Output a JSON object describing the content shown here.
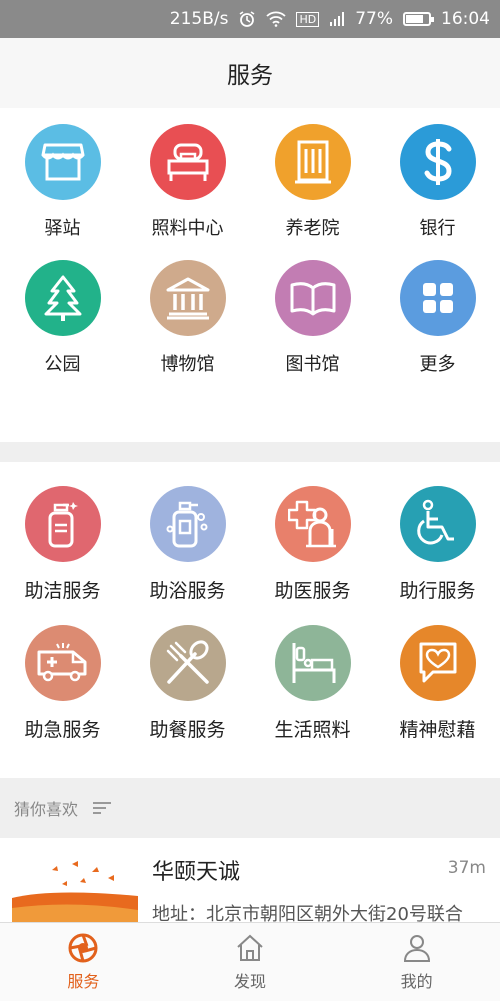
{
  "status_bar": {
    "speed": "215B/s",
    "hd_badge": "HD",
    "battery": "77%",
    "battery_level": 0.77,
    "time": "16:04"
  },
  "header": {
    "title": "服务"
  },
  "places": [
    {
      "label": "驿站",
      "icon": "store-icon",
      "color": "#5bbde4"
    },
    {
      "label": "照料中心",
      "icon": "bed-icon",
      "color": "#e84f53"
    },
    {
      "label": "养老院",
      "icon": "building-icon",
      "color": "#f0a12c"
    },
    {
      "label": "银行",
      "icon": "dollar-icon",
      "color": "#2b9bd8"
    },
    {
      "label": "公园",
      "icon": "tree-icon",
      "color": "#22b28a"
    },
    {
      "label": "博物馆",
      "icon": "museum-icon",
      "color": "#cfaa8c"
    },
    {
      "label": "图书馆",
      "icon": "book-icon",
      "color": "#c27db3"
    },
    {
      "label": "更多",
      "icon": "grid-icon",
      "color": "#5b9cdf"
    }
  ],
  "services": [
    {
      "label": "助洁服务",
      "icon": "cleaning-bottle-icon",
      "color": "#e0676f"
    },
    {
      "label": "助浴服务",
      "icon": "bath-bottle-icon",
      "color": "#9fb3de"
    },
    {
      "label": "助医服务",
      "icon": "elder-medical-icon",
      "color": "#e8806b"
    },
    {
      "label": "助行服务",
      "icon": "wheelchair-icon",
      "color": "#27a0b3"
    },
    {
      "label": "助急服务",
      "icon": "ambulance-icon",
      "color": "#dc8b72"
    },
    {
      "label": "助餐服务",
      "icon": "fork-spoon-icon",
      "color": "#b8a78d"
    },
    {
      "label": "生活照料",
      "icon": "hospital-bed-icon",
      "color": "#8eb598"
    },
    {
      "label": "精神慰藉",
      "icon": "heart-chat-icon",
      "color": "#e6872a"
    }
  ],
  "recommend": {
    "header": "猜你喜欢",
    "item": {
      "title": "华颐天诚",
      "distance": "37m",
      "address": "地址：北京市朝阳区朝外大街20号联合"
    }
  },
  "tabs": [
    {
      "label": "服务",
      "icon": "aperture-icon",
      "active": true
    },
    {
      "label": "发现",
      "icon": "home-icon",
      "active": false
    },
    {
      "label": "我的",
      "icon": "person-icon",
      "active": false
    }
  ],
  "colors": {
    "accent": "#e2611c"
  }
}
